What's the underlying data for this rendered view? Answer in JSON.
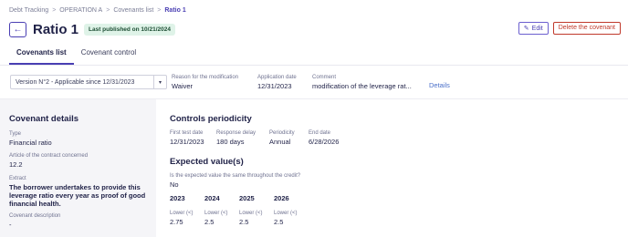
{
  "breadcrumb": [
    "Debt Tracking",
    "OPERATION A",
    "Covenants list",
    "Ratio 1"
  ],
  "breadcrumb_sep": ">",
  "header": {
    "back_glyph": "←",
    "title": "Ratio 1",
    "badge": "Last published on 10/21/2024"
  },
  "actions": {
    "edit_icon": "✎",
    "edit_label": "Edit",
    "delete_label": "Delete the covenant"
  },
  "tabs": [
    {
      "label": "Covenants list",
      "active": true
    },
    {
      "label": "Covenant control",
      "active": false
    }
  ],
  "version": {
    "selected": "Version N°2 - Applicable since 12/31/2023",
    "caret": "▾"
  },
  "meta": {
    "reason_label": "Reason for the modification",
    "reason_value": "Waiver",
    "application_label": "Application date",
    "application_value": "12/31/2023",
    "comment_label": "Comment",
    "comment_value": "modification of the leverage rat...",
    "details_link": "Details"
  },
  "covenant_details": {
    "title": "Covenant details",
    "type_label": "Type",
    "type_value": "Financial ratio",
    "article_label": "Article of the contract concerned",
    "article_value": "12.2",
    "extract_label": "Extract",
    "extract_value": "The borrower undertakes to provide this leverage ratio every year as proof of good financial health.",
    "description_label": "Covenant description",
    "description_value": "-"
  },
  "controls": {
    "title": "Controls periodicity",
    "first_test_label": "First test date",
    "first_test_value": "12/31/2023",
    "response_label": "Response delay",
    "response_value": "180 days",
    "periodicity_label": "Periodicity",
    "periodicity_value": "Annual",
    "end_label": "End date",
    "end_value": "6/28/2026"
  },
  "expected": {
    "title": "Expected value(s)",
    "question": "Is the expected value the same throughout the credit?",
    "answer": "No",
    "years": [
      {
        "year": "2023",
        "label": "Lower (<)",
        "value": "2.75"
      },
      {
        "year": "2024",
        "label": "Lower (<)",
        "value": "2.5"
      },
      {
        "year": "2025",
        "label": "Lower (<)",
        "value": "2.5"
      },
      {
        "year": "2026",
        "label": "Lower (<)",
        "value": "2.5"
      }
    ]
  }
}
